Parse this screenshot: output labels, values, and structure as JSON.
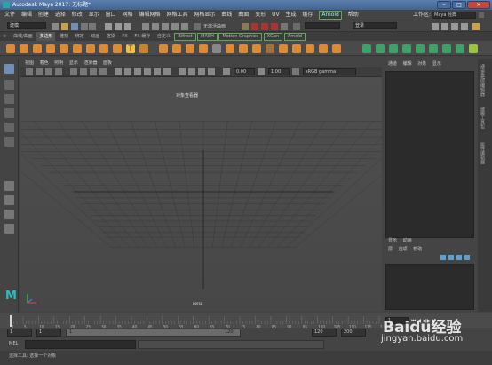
{
  "window": {
    "title": "Autodesk Maya 2017: 无标题*",
    "minimize": "–",
    "maximize": "□",
    "close": "✕"
  },
  "menubar": {
    "items": [
      "文件",
      "编辑",
      "创建",
      "选择",
      "修改",
      "显示",
      "窗口",
      "网格",
      "编辑网格",
      "网格工具",
      "网格显示",
      "曲线",
      "曲面",
      "变形",
      "UV",
      "生成",
      "缓存",
      "Arnold",
      "帮助"
    ],
    "workspace_label": "工作区:",
    "workspace_value": "Maya 经典"
  },
  "statusline": {
    "menuset": "建模",
    "no_live_surface": "无激活曲面",
    "login": "登录"
  },
  "shelf_tabs": [
    "曲线/曲面",
    "多边形",
    "雕刻",
    "绑定",
    "动画",
    "渲染",
    "FX",
    "FX 缓存",
    "自定义",
    "Bifrost",
    "MASH",
    "Motion Graphics",
    "XGen",
    "Arnold"
  ],
  "panel_menu": [
    "视图",
    "着色",
    "照明",
    "显示",
    "渲染器",
    "面板"
  ],
  "panel_toolbar": {
    "value1": "0.00",
    "value2": "1.00",
    "color_space": "sRGB gamma"
  },
  "viewport": {
    "hud_title": "对象查看器",
    "camera_label": "persp"
  },
  "channel_box": {
    "menu": [
      "通道",
      "编辑",
      "对象",
      "显示"
    ],
    "layer_tabs": [
      "显示",
      "动画"
    ],
    "layer_menu": [
      "层",
      "选项",
      "帮助"
    ]
  },
  "side_tabs": [
    "通道盒/层编辑器",
    "建模工具包",
    "属性编辑器"
  ],
  "timeslider": {
    "ticks": [
      "1",
      "5",
      "10",
      "15",
      "20",
      "25",
      "30",
      "35",
      "40",
      "45",
      "50",
      "55",
      "60",
      "65",
      "70",
      "75",
      "80",
      "85",
      "90",
      "95",
      "100",
      "105",
      "110",
      "115",
      "120"
    ],
    "current_frame": "1"
  },
  "range": {
    "start": "1",
    "start_inner": "1",
    "slider_start": "1",
    "slider_end": "120",
    "end_inner": "120",
    "end": "200"
  },
  "command_line": {
    "label": "MEL"
  },
  "help_line": {
    "text": "选择工具: 选择一个对象"
  },
  "watermark": {
    "brand": "Baidu经验",
    "url": "jingyan.baidu.com"
  }
}
